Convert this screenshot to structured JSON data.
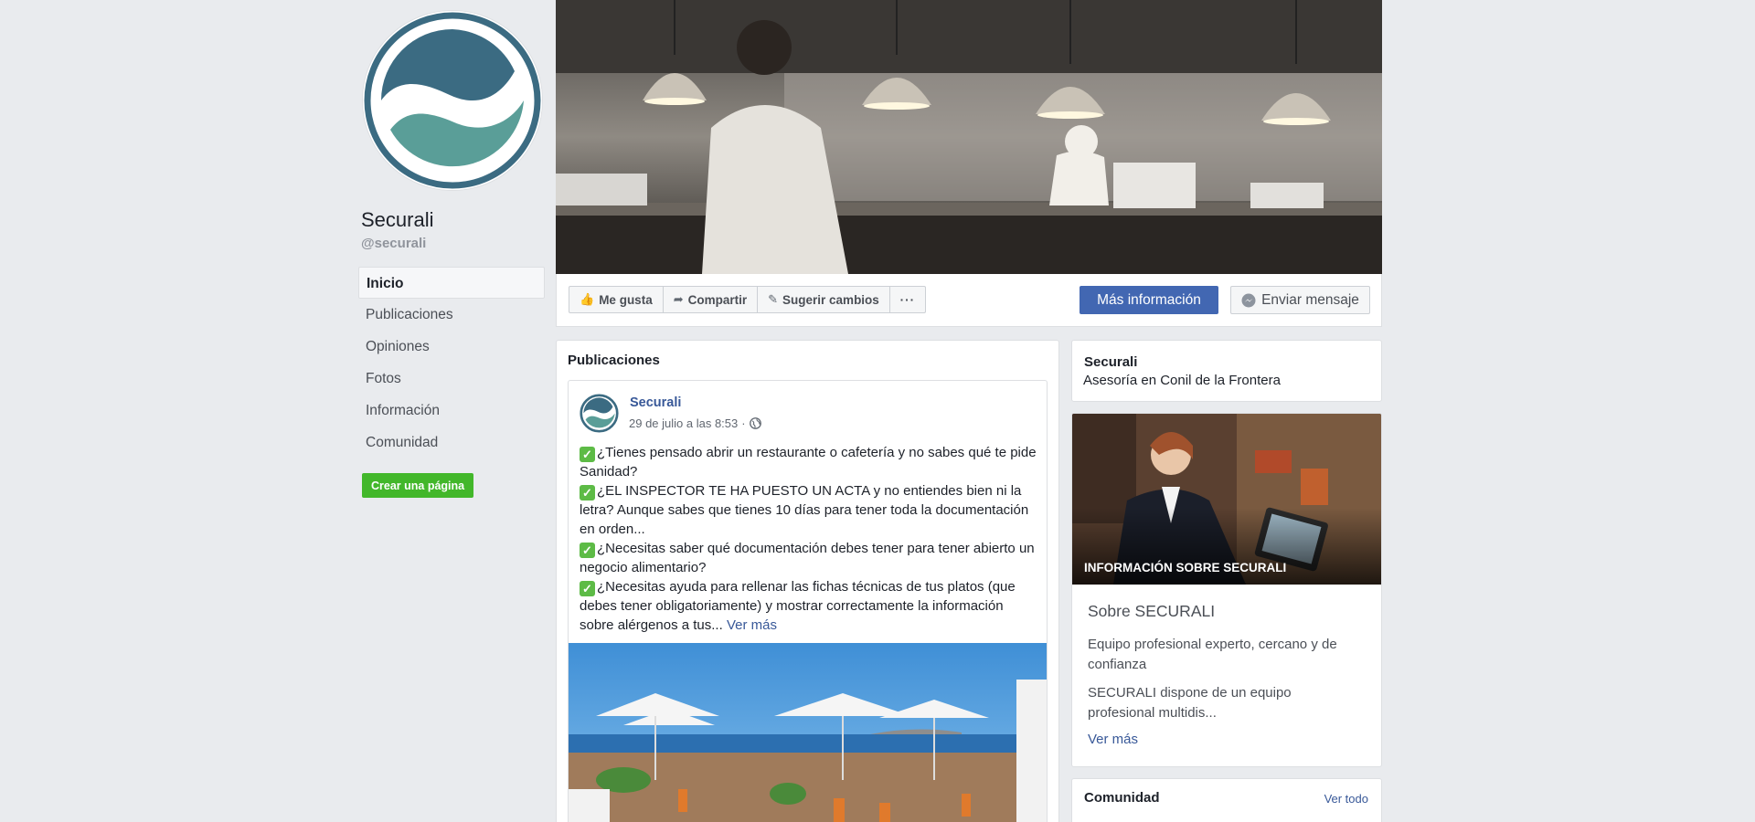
{
  "page": {
    "name": "Securali",
    "handle": "@securali"
  },
  "nav": {
    "items": [
      {
        "label": "Inicio",
        "active": true
      },
      {
        "label": "Publicaciones",
        "active": false
      },
      {
        "label": "Opiniones",
        "active": false
      },
      {
        "label": "Fotos",
        "active": false
      },
      {
        "label": "Información",
        "active": false
      },
      {
        "label": "Comunidad",
        "active": false
      }
    ],
    "create_page": "Crear una página"
  },
  "actions": {
    "like": "Me gusta",
    "share": "Compartir",
    "suggest": "Sugerir cambios",
    "more": "···",
    "more_info": "Más información",
    "send_message": "Enviar mensaje"
  },
  "posts": {
    "section_title": "Publicaciones",
    "post": {
      "author": "Securali",
      "timestamp": "29 de julio a las 8:53",
      "separator": "·",
      "paragraphs": [
        "¿Tienes pensado abrir un restaurante o cafetería y no sabes qué te pide Sanidad?",
        "¿EL INSPECTOR TE HA PUESTO UN ACTA y no entiendes bien ni la letra? Aunque sabes que tienes 10 días para tener toda la documentación en orden...",
        "¿Necesitas saber qué documentación debes tener para tener abierto un negocio alimentario?",
        "¿Necesitas ayuda para rellenar las fichas técnicas de tus platos (que debes tener obligatoriamente) y mostrar correctamente la información sobre alérgenos a tus..."
      ],
      "see_more": "Ver más"
    }
  },
  "about": {
    "name": "Securali",
    "category": "Asesoría en Conil de la Frontera"
  },
  "info": {
    "image_label": "INFORMACIÓN SOBRE SECURALI",
    "title": "Sobre SECURALI",
    "text1": "Equipo profesional experto, cercano y de confianza",
    "text2": "SECURALI dispone de un equipo profesional multidis...",
    "see_more": "Ver más"
  },
  "community": {
    "title": "Comunidad",
    "see_all": "Ver todo"
  },
  "colors": {
    "brand_blue": "#4267b2",
    "link": "#385898",
    "green": "#42b72a",
    "logo_dark": "#3b6b82",
    "logo_teal": "#5a9e98"
  }
}
